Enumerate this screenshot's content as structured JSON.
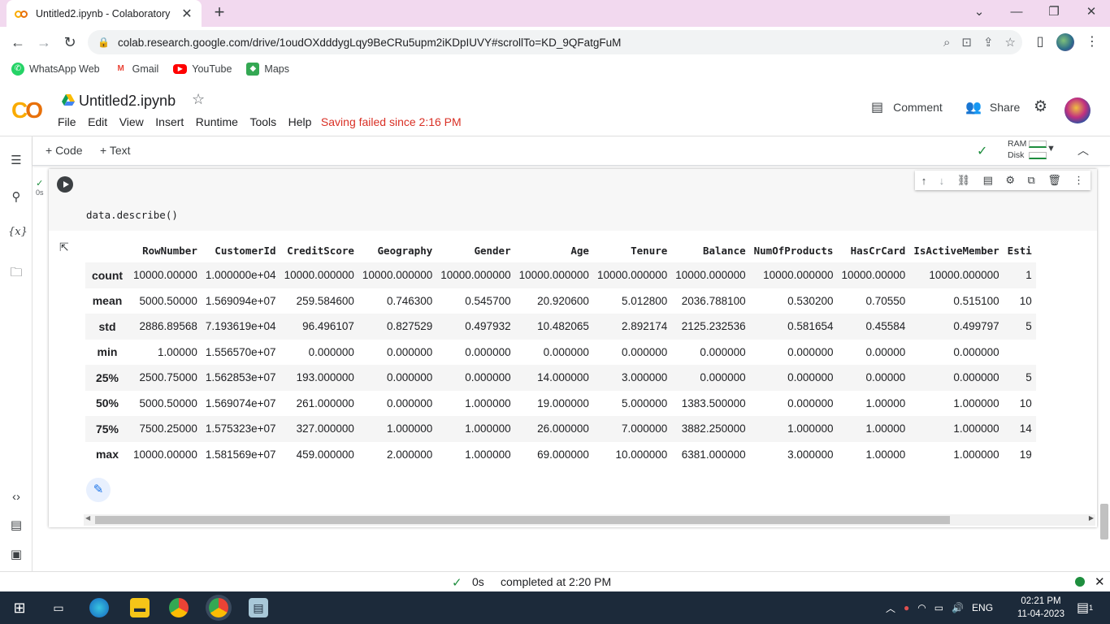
{
  "browser": {
    "tab_title": "Untitled2.ipynb - Colaboratory",
    "url": "colab.research.google.com/drive/1oudOXdddygLqy9BeCRu5upm2iKDpIUVY#scrollTo=KD_9QFatgFuM"
  },
  "bookmarks": [
    {
      "label": "WhatsApp Web",
      "color": "#25d366"
    },
    {
      "label": "Gmail",
      "color": "#ea4335"
    },
    {
      "label": "YouTube",
      "color": "#ff0000"
    },
    {
      "label": "Maps",
      "color": "#34a853"
    }
  ],
  "colab": {
    "notebook_title": "Untitled2.ipynb",
    "menu": [
      "File",
      "Edit",
      "View",
      "Insert",
      "Runtime",
      "Tools",
      "Help"
    ],
    "saving_status": "Saving failed since 2:16 PM",
    "comment_label": "Comment",
    "share_label": "Share",
    "add_code_label": "+ Code",
    "add_text_label": "+ Text",
    "ram_label": "RAM",
    "disk_label": "Disk"
  },
  "cell": {
    "exec_time": "0s",
    "code": "data.describe()"
  },
  "table": {
    "columns": [
      "RowNumber",
      "CustomerId",
      "CreditScore",
      "Geography",
      "Gender",
      "Age",
      "Tenure",
      "Balance",
      "NumOfProducts",
      "HasCrCard",
      "IsActiveMember",
      "Esti"
    ],
    "rows": [
      {
        "label": "count",
        "values": [
          "10000.00000",
          "1.000000e+04",
          "10000.000000",
          "10000.000000",
          "10000.000000",
          "10000.000000",
          "10000.000000",
          "10000.000000",
          "10000.000000",
          "10000.00000",
          "10000.000000",
          "1"
        ]
      },
      {
        "label": "mean",
        "values": [
          "5000.50000",
          "1.569094e+07",
          "259.584600",
          "0.746300",
          "0.545700",
          "20.920600",
          "5.012800",
          "2036.788100",
          "0.530200",
          "0.70550",
          "0.515100",
          "10"
        ]
      },
      {
        "label": "std",
        "values": [
          "2886.89568",
          "7.193619e+04",
          "96.496107",
          "0.827529",
          "0.497932",
          "10.482065",
          "2.892174",
          "2125.232536",
          "0.581654",
          "0.45584",
          "0.499797",
          "5"
        ]
      },
      {
        "label": "min",
        "values": [
          "1.00000",
          "1.556570e+07",
          "0.000000",
          "0.000000",
          "0.000000",
          "0.000000",
          "0.000000",
          "0.000000",
          "0.000000",
          "0.00000",
          "0.000000",
          ""
        ]
      },
      {
        "label": "25%",
        "values": [
          "2500.75000",
          "1.562853e+07",
          "193.000000",
          "0.000000",
          "0.000000",
          "14.000000",
          "3.000000",
          "0.000000",
          "0.000000",
          "0.00000",
          "0.000000",
          "5"
        ]
      },
      {
        "label": "50%",
        "values": [
          "5000.50000",
          "1.569074e+07",
          "261.000000",
          "0.000000",
          "1.000000",
          "19.000000",
          "5.000000",
          "1383.500000",
          "0.000000",
          "1.00000",
          "1.000000",
          "10"
        ]
      },
      {
        "label": "75%",
        "values": [
          "7500.25000",
          "1.575323e+07",
          "327.000000",
          "1.000000",
          "1.000000",
          "26.000000",
          "7.000000",
          "3882.250000",
          "1.000000",
          "1.00000",
          "1.000000",
          "14"
        ]
      },
      {
        "label": "max",
        "values": [
          "10000.00000",
          "1.581569e+07",
          "459.000000",
          "2.000000",
          "1.000000",
          "69.000000",
          "10.000000",
          "6381.000000",
          "3.000000",
          "1.00000",
          "1.000000",
          "19"
        ]
      }
    ]
  },
  "status": {
    "time": "0s",
    "message": "completed at 2:20 PM"
  },
  "taskbar": {
    "lang": "ENG",
    "time": "02:21 PM",
    "date": "11-04-2023",
    "notifications": "1"
  }
}
